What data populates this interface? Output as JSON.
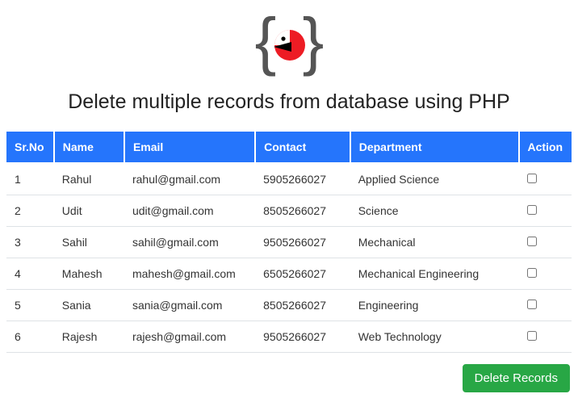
{
  "title": "Delete multiple records from database using PHP",
  "table": {
    "headers": {
      "sr": "Sr.No",
      "name": "Name",
      "email": "Email",
      "contact": "Contact",
      "department": "Department",
      "action": "Action"
    },
    "rows": [
      {
        "sr": "1",
        "name": "Rahul",
        "email": "rahul@gmail.com",
        "contact": "5905266027",
        "department": "Applied Science"
      },
      {
        "sr": "2",
        "name": "Udit",
        "email": "udit@gmail.com",
        "contact": "8505266027",
        "department": "Science"
      },
      {
        "sr": "3",
        "name": "Sahil",
        "email": "sahil@gmail.com",
        "contact": "9505266027",
        "department": "Mechanical"
      },
      {
        "sr": "4",
        "name": "Mahesh",
        "email": "mahesh@gmail.com",
        "contact": "6505266027",
        "department": "Mechanical Engineering"
      },
      {
        "sr": "5",
        "name": "Sania",
        "email": "sania@gmail.com",
        "contact": "8505266027",
        "department": "Engineering"
      },
      {
        "sr": "6",
        "name": "Rajesh",
        "email": "rajesh@gmail.com",
        "contact": "9505266027",
        "department": "Web Technology"
      }
    ]
  },
  "buttons": {
    "delete": "Delete Records"
  }
}
